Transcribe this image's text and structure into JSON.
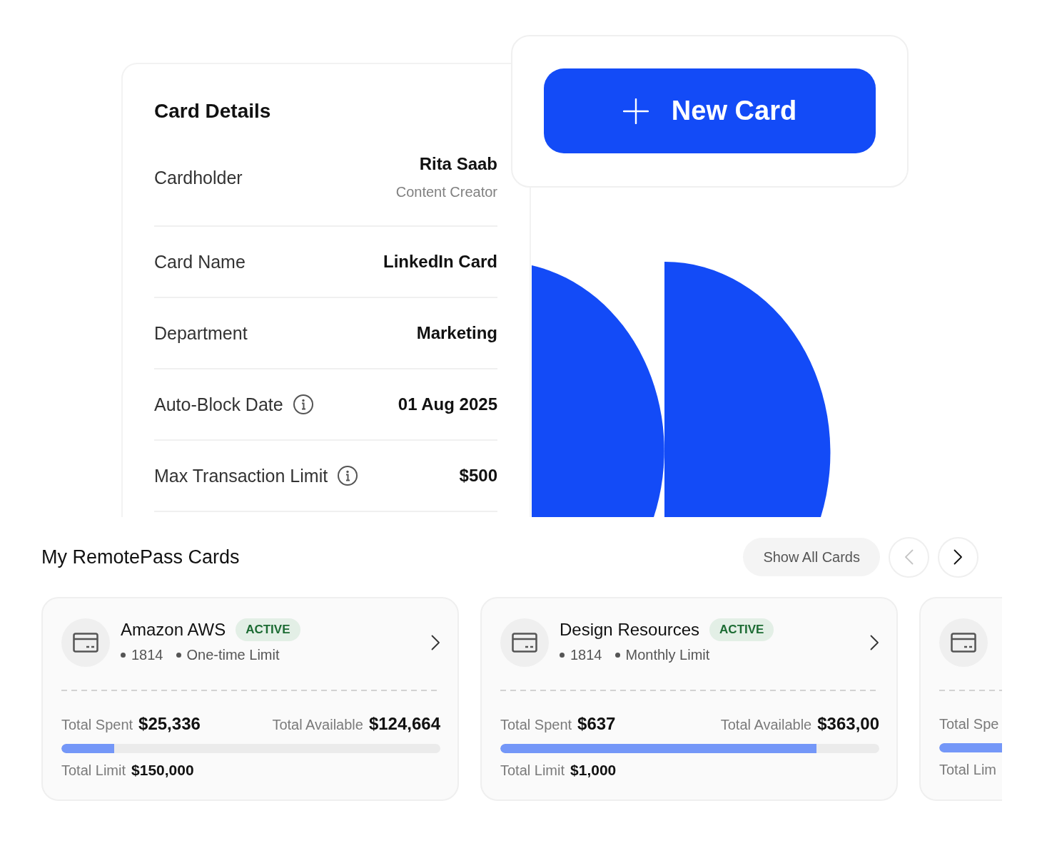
{
  "card_details": {
    "title": "Card Details",
    "rows": [
      {
        "label": "Cardholder",
        "value": "Rita Saab",
        "subvalue": "Content Creator",
        "info": false
      },
      {
        "label": "Card Name",
        "value": "LinkedIn Card",
        "info": false
      },
      {
        "label": "Department",
        "value": "Marketing",
        "info": false
      },
      {
        "label": "Auto-Block Date",
        "value": "01 Aug 2025",
        "info": true
      },
      {
        "label": "Max Transaction Limit",
        "value": "$500",
        "info": true
      }
    ]
  },
  "new_card_button": {
    "label": "New Card"
  },
  "cards_section": {
    "title": "My RemotePass Cards",
    "show_all_button": "Show All Cards",
    "pager": {
      "previous": {
        "disabled": true
      },
      "next": {
        "disabled": false
      }
    },
    "cards": [
      {
        "kind": "full",
        "name": "Amazon AWS",
        "status": "ACTIVE",
        "last_digits": "1814",
        "limit_type": "One-time Limit",
        "spent_label": "Total Spent",
        "spent": "$25,336",
        "available_label": "Total Available",
        "available": "$124,664",
        "level": 0.14,
        "limit_label": "Total Limit",
        "limit": "$150,000"
      },
      {
        "kind": "full",
        "name": "Design Resources",
        "status": "ACTIVE",
        "last_digits": "1814",
        "limit_type": "Monthly Limit",
        "spent_label": "Total Spent",
        "spent": "$637",
        "available_label": "Total Available",
        "available": "$363,00",
        "level": 0.834,
        "limit_label": "Total Limit",
        "limit": "$1,000"
      },
      {
        "kind": "clipped",
        "spent_label": "Total Spe",
        "level": 1,
        "limit_label": "Total Lim"
      }
    ]
  }
}
